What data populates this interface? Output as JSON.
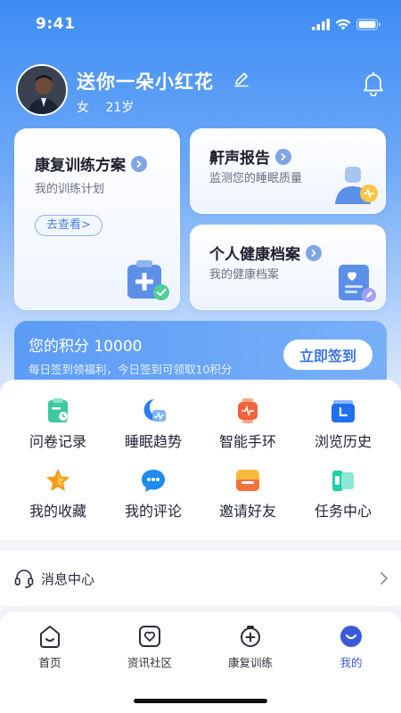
{
  "status_bar": {
    "time": "9:41"
  },
  "profile": {
    "name": "送你一朵小红花",
    "gender": "女",
    "age": "21岁"
  },
  "cards": {
    "plan": {
      "title": "康复训练方案",
      "subtitle": "我的训练计划",
      "button": "去查看>"
    },
    "snore": {
      "title": "鼾声报告",
      "subtitle": "监测您的睡眠质量"
    },
    "archive": {
      "title": "个人健康档案",
      "subtitle": "我的健康档案"
    }
  },
  "points": {
    "title": "您的积分 10000",
    "description": "每日签到领福利，今日签到可领取10积分",
    "signin_button": "立即签到"
  },
  "grid": [
    {
      "label": "问卷记录",
      "icon": "questionnaire-icon"
    },
    {
      "label": "睡眠趋势",
      "icon": "sleep-trend-icon"
    },
    {
      "label": "智能手环",
      "icon": "smart-band-icon"
    },
    {
      "label": "浏览历史",
      "icon": "history-icon"
    },
    {
      "label": "我的收藏",
      "icon": "favorites-star-icon"
    },
    {
      "label": "我的评论",
      "icon": "comments-icon"
    },
    {
      "label": "邀请好友",
      "icon": "invite-icon"
    },
    {
      "label": "任务中心",
      "icon": "task-center-icon"
    }
  ],
  "message_center": {
    "label": "消息中心"
  },
  "tabs": [
    {
      "label": "首页",
      "icon": "home-icon"
    },
    {
      "label": "资讯社区",
      "icon": "community-icon"
    },
    {
      "label": "康复训练",
      "icon": "training-icon"
    },
    {
      "label": "我的",
      "icon": "profile-icon",
      "active": true
    }
  ],
  "colors": {
    "primary": "#3d8cf5",
    "active_tab": "#3b5bd6",
    "signin_text": "#3c78e0"
  }
}
